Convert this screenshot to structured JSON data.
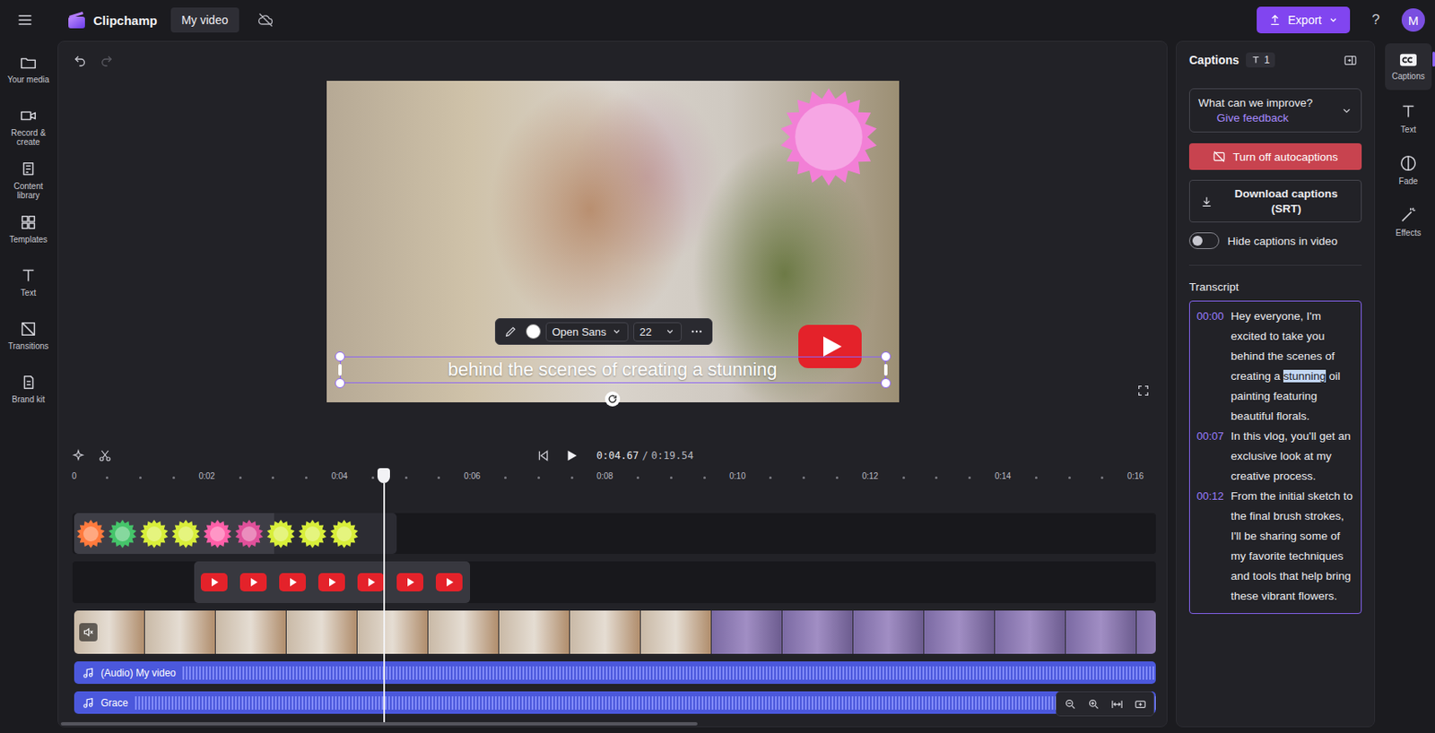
{
  "app": {
    "name": "Clipchamp",
    "project_title": "My video",
    "export_label": "Export",
    "help": "?",
    "avatar": "M"
  },
  "sidebar": {
    "items": [
      {
        "label": "Your media",
        "selected": false
      },
      {
        "label": "Record & create",
        "selected": false
      },
      {
        "label": "Content library",
        "selected": false
      },
      {
        "label": "Templates",
        "selected": false
      },
      {
        "label": "Text",
        "selected": false
      },
      {
        "label": "Transitions",
        "selected": false
      },
      {
        "label": "Brand kit",
        "selected": false
      }
    ]
  },
  "preview": {
    "caption_text": "behind the scenes of creating a stunning",
    "text_toolbar": {
      "color": "#ffffff",
      "font": "Open Sans",
      "size": "22"
    }
  },
  "playback": {
    "current": "0:04.67",
    "separator": "/",
    "total": "0:19.54",
    "playing": false
  },
  "timeline": {
    "ruler": [
      "0",
      "0:02",
      "0:04",
      "0:06",
      "0:08",
      "0:10",
      "0:12",
      "0:14",
      "0:16"
    ],
    "tracks": [
      {
        "kind": "stickers"
      },
      {
        "kind": "overlay"
      },
      {
        "kind": "video",
        "muted": true
      },
      {
        "kind": "audio",
        "label": "(Audio) My video"
      },
      {
        "kind": "audio",
        "label": "Grace"
      }
    ]
  },
  "captions": {
    "title": "Captions",
    "count": "1",
    "feedback": {
      "question": "What can we improve?",
      "link": "Give feedback"
    },
    "turn_off_label": "Turn off autocaptions",
    "download_label": "Download captions (SRT)",
    "hide_toggle": {
      "label": "Hide captions in video",
      "on": false
    },
    "transcript_title": "Transcript",
    "entries": [
      {
        "time": "00:00",
        "parts": [
          {
            "text": "Hey everyone, I'm excited to take you behind the scenes of creating a ",
            "highlighted": false
          },
          {
            "text": "stunning",
            "highlighted": true
          },
          {
            "text": " oil painting featuring beautiful florals.",
            "highlighted": false
          }
        ]
      },
      {
        "time": "00:07",
        "parts": [
          {
            "text": "In this vlog, you'll get an exclusive look at my creative process.",
            "highlighted": false
          }
        ]
      },
      {
        "time": "00:12",
        "parts": [
          {
            "text": "From the initial sketch to the final brush strokes, I'll be sharing some of my favorite techniques and tools that help bring these vibrant flowers.",
            "highlighted": false
          }
        ]
      }
    ]
  },
  "rail": [
    {
      "label": "Captions",
      "selected": true
    },
    {
      "label": "Text",
      "selected": false
    },
    {
      "label": "Fade",
      "selected": false
    },
    {
      "label": "Effects",
      "selected": false
    }
  ]
}
